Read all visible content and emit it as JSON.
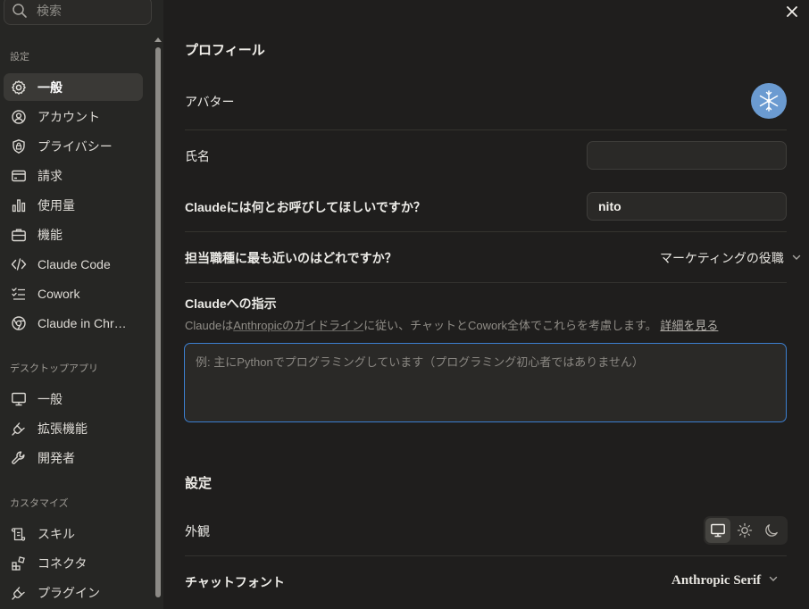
{
  "sidebar": {
    "search_placeholder": "検索",
    "sections": {
      "settings": "設定",
      "desktop": "デスクトップアプリ",
      "customize": "カスタマイズ"
    },
    "items": [
      {
        "label": "一般",
        "icon": "gear-icon",
        "active": true
      },
      {
        "label": "アカウント",
        "icon": "user-circle-icon"
      },
      {
        "label": "プライバシー",
        "icon": "shield-lock-icon"
      },
      {
        "label": "請求",
        "icon": "credit-card-icon"
      },
      {
        "label": "使用量",
        "icon": "bar-chart-icon"
      },
      {
        "label": "機能",
        "icon": "briefcase-icon"
      },
      {
        "label": "Claude Code",
        "icon": "code-icon"
      },
      {
        "label": "Cowork",
        "icon": "checklist-icon"
      },
      {
        "label": "Claude in Chr…",
        "icon": "chrome-icon"
      },
      {
        "label": "一般",
        "icon": "monitor-icon"
      },
      {
        "label": "拡張機能",
        "icon": "plug-icon"
      },
      {
        "label": "開発者",
        "icon": "wrench-icon"
      },
      {
        "label": "スキル",
        "icon": "scroll-icon"
      },
      {
        "label": "コネクタ",
        "icon": "connector-icon"
      },
      {
        "label": "プラグイン",
        "icon": "plug-icon"
      }
    ]
  },
  "profile": {
    "heading": "プロフィール",
    "avatar_label": "アバター",
    "name_label": "氏名",
    "name_value": "",
    "call_label": "Claudeには何とお呼びしてほしいですか？",
    "call_value": "nito",
    "role_label": "担当職種に最も近いのはどれですか？",
    "role_value": "マーケティングの役職",
    "instructions_label": "Claudeへの指示",
    "instructions_desc_1": "Claudeは",
    "instructions_desc_2": "Anthropicのガイドライン",
    "instructions_desc_3": "に従い、チャットとCowork全体でこれらを考慮します。",
    "instructions_desc_link": "詳細を見る",
    "instructions_placeholder": "例: 主にPythonでプログラミングしています（プログラミング初心者ではありません）"
  },
  "settings": {
    "heading": "設定",
    "appearance_label": "外観",
    "appearance_selected": "system",
    "font_label": "チャットフォント",
    "font_value": "Anthropic Serif"
  },
  "colors": {
    "accent": "#3c7fd0",
    "avatar_bg": "#6b9bd1",
    "background": "#1f1e1d",
    "sidebar": "#262624"
  }
}
